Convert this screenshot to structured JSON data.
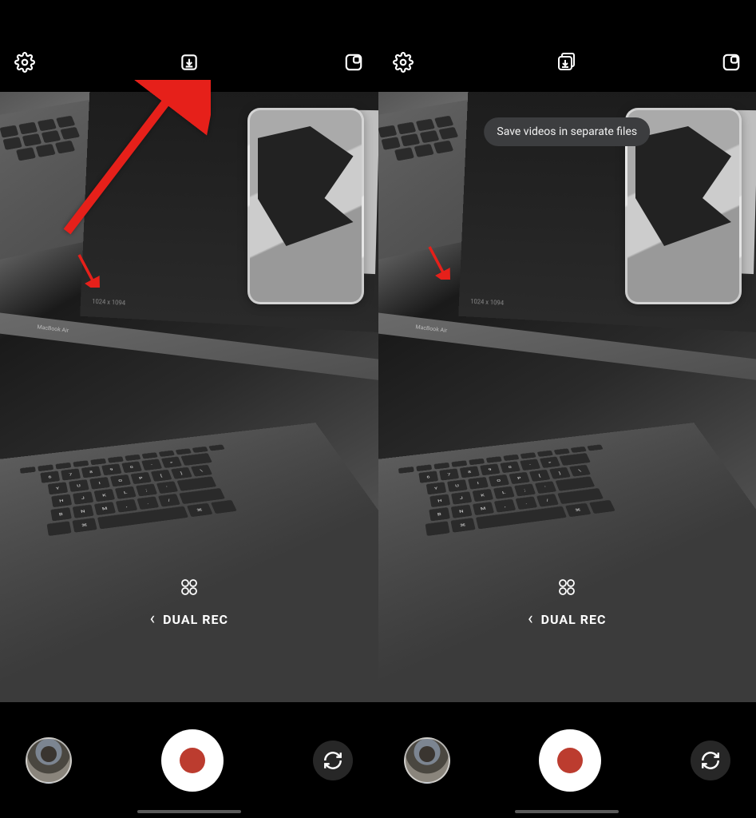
{
  "domain": "Computer-Use",
  "tooltip_text": "Save videos in separate files",
  "mode_label": "DUAL REC",
  "screen_res_label": "1024 x 1094",
  "laptop_label": "MacBook Air",
  "icons": {
    "settings": "settings-icon",
    "save_single": "save-video-icon",
    "save_multi": "save-video-multi-icon",
    "pip_layout": "pip-layout-icon",
    "grid": "grid-icon",
    "switch": "camera-switch-icon"
  },
  "phones": [
    {
      "id": "left",
      "save_variant": "single",
      "show_arrow": true,
      "show_tooltip": false
    },
    {
      "id": "right",
      "save_variant": "multi",
      "show_arrow": false,
      "show_tooltip": true
    }
  ]
}
